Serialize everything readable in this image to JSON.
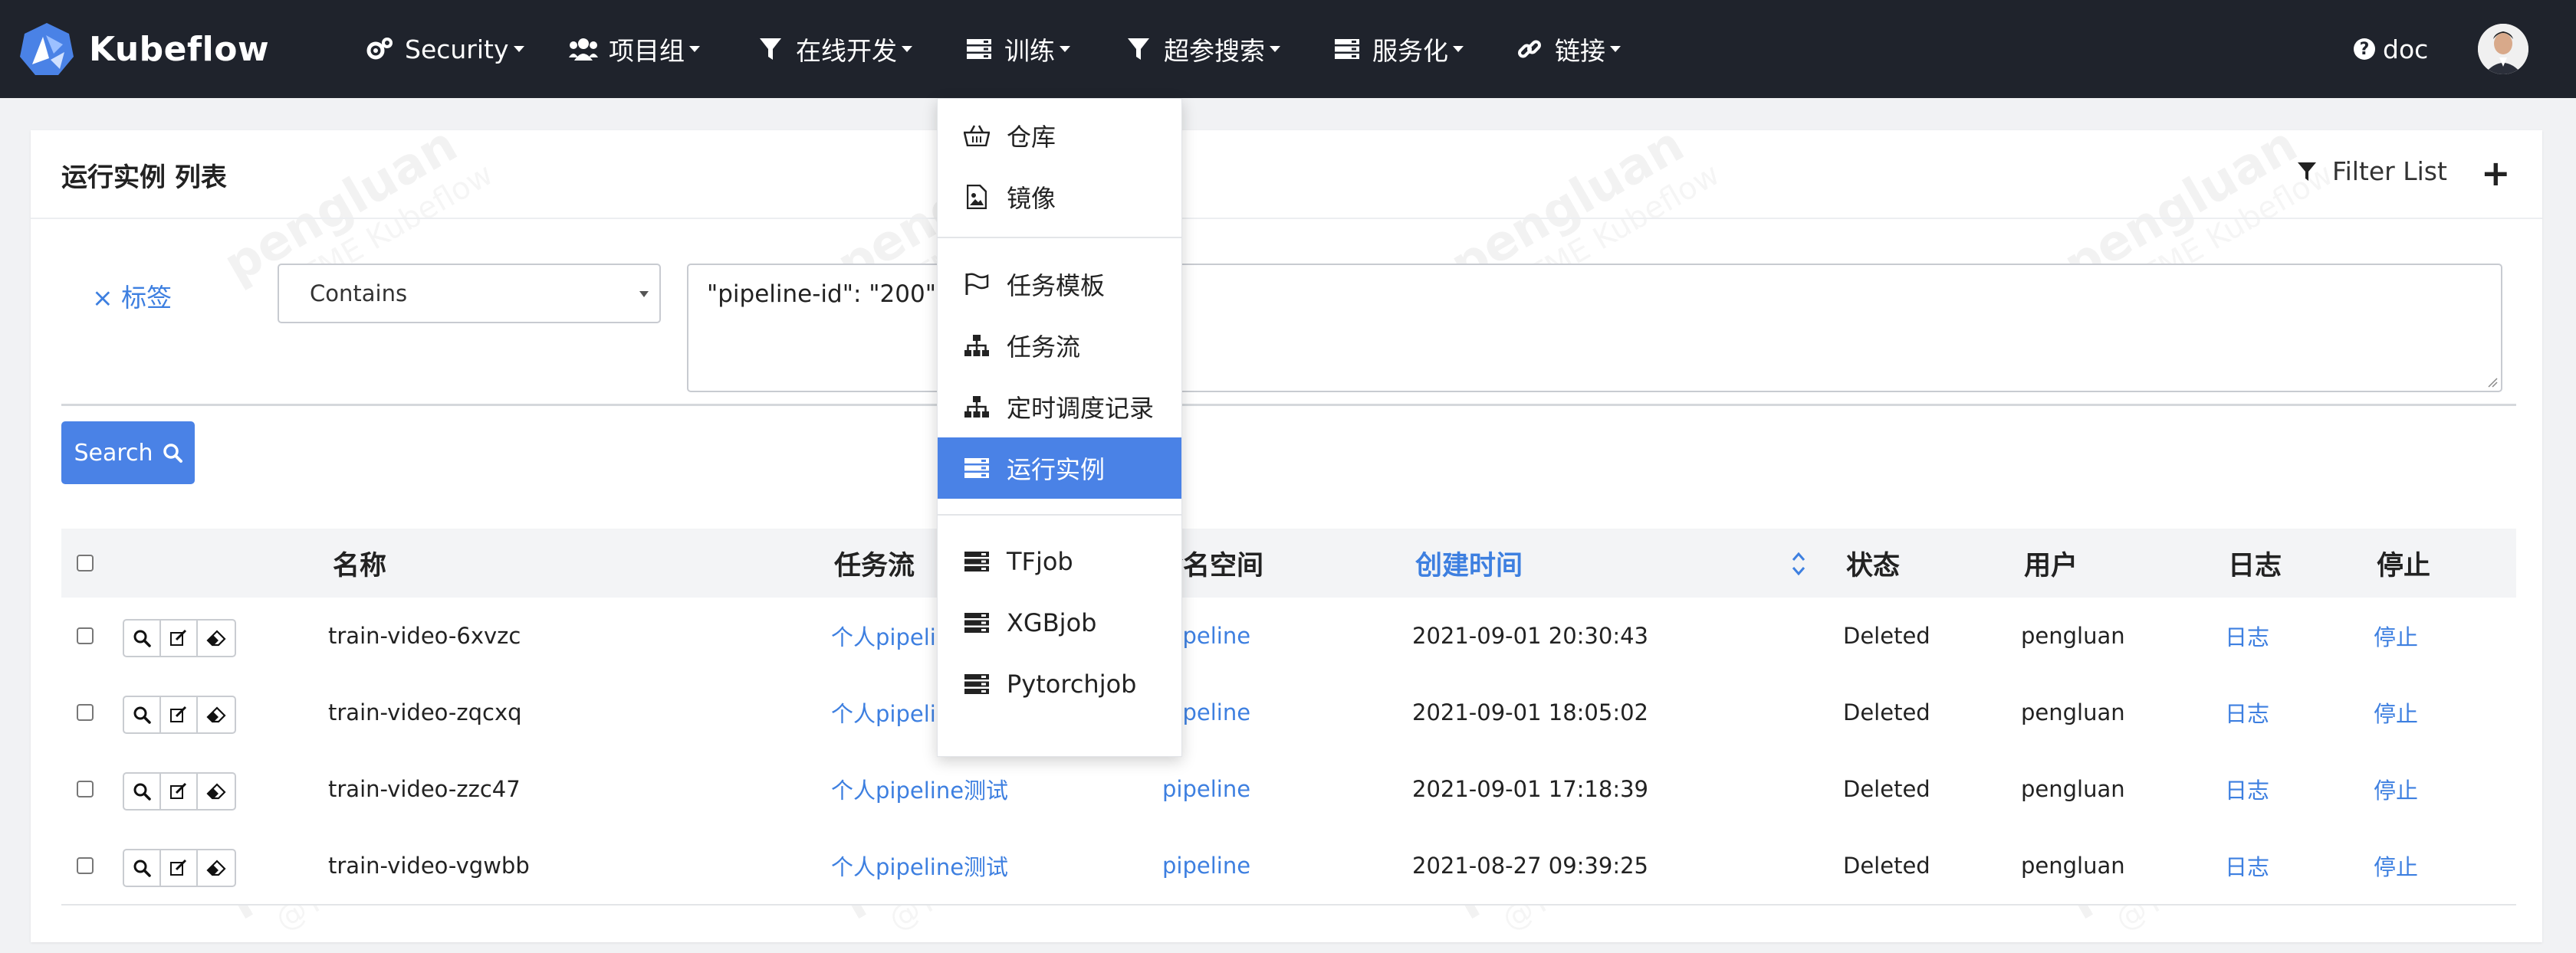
{
  "brand": {
    "name": "Kubeflow"
  },
  "nav": {
    "items": [
      {
        "label": "Security",
        "icon": "cogs-icon"
      },
      {
        "label": "项目组",
        "icon": "users-icon"
      },
      {
        "label": "在线开发",
        "icon": "filter-icon"
      },
      {
        "label": "训练",
        "icon": "server-icon"
      },
      {
        "label": "超参搜索",
        "icon": "filter-icon"
      },
      {
        "label": "服务化",
        "icon": "server-icon"
      },
      {
        "label": "链接",
        "icon": "link-icon"
      }
    ],
    "doc_label": "doc"
  },
  "panel": {
    "title": "运行实例 列表",
    "filter_list_label": "Filter List",
    "add_label": "+"
  },
  "filter": {
    "remove_tag_label": "× 标签",
    "operator": "Contains",
    "value": "\"pipeline-id\": \"200\"",
    "search_label": "Search"
  },
  "table": {
    "headers": {
      "name": "名称",
      "pipeline": "任务流",
      "namespace": "命名空间",
      "created": "创建时间",
      "status": "状态",
      "user": "用户",
      "log": "日志",
      "stop": "停止"
    },
    "rows": [
      {
        "name": "train-video-6xvzc",
        "pipeline": "个人pipeline测试",
        "namespace": "pipeline",
        "created": "2021-09-01 20:30:43",
        "status": "Deleted",
        "user": "pengluan",
        "log": "日志",
        "stop": "停止"
      },
      {
        "name": "train-video-zqcxq",
        "pipeline": "个人pipeline测试",
        "namespace": "pipeline",
        "created": "2021-09-01 18:05:02",
        "status": "Deleted",
        "user": "pengluan",
        "log": "日志",
        "stop": "停止"
      },
      {
        "name": "train-video-zzc47",
        "pipeline": "个人pipeline测试",
        "namespace": "pipeline",
        "created": "2021-09-01 17:18:39",
        "status": "Deleted",
        "user": "pengluan",
        "log": "日志",
        "stop": "停止"
      },
      {
        "name": "train-video-vgwbb",
        "pipeline": "个人pipeline测试",
        "namespace": "pipeline",
        "created": "2021-08-27 09:39:25",
        "status": "Deleted",
        "user": "pengluan",
        "log": "日志",
        "stop": "停止"
      }
    ]
  },
  "dropdown": {
    "items": [
      {
        "label": "仓库",
        "icon": "basket-icon"
      },
      {
        "label": "镜像",
        "icon": "image-file-icon"
      },
      {
        "label": "任务模板",
        "icon": "flag-icon"
      },
      {
        "label": "任务流",
        "icon": "sitemap-icon"
      },
      {
        "label": "定时调度记录",
        "icon": "sitemap-icon"
      },
      {
        "label": "运行实例",
        "icon": "server-icon",
        "active": true
      },
      {
        "label": "TFjob",
        "icon": "server-icon"
      },
      {
        "label": "XGBjob",
        "icon": "server-icon"
      },
      {
        "label": "Pytorchjob",
        "icon": "server-icon"
      }
    ]
  },
  "watermark": {
    "name": "pengluan",
    "org": "@TME Kubeflow"
  },
  "colors": {
    "nav_bg": "#1f232c",
    "accent": "#4a82e6",
    "link": "#3d7fe0"
  }
}
